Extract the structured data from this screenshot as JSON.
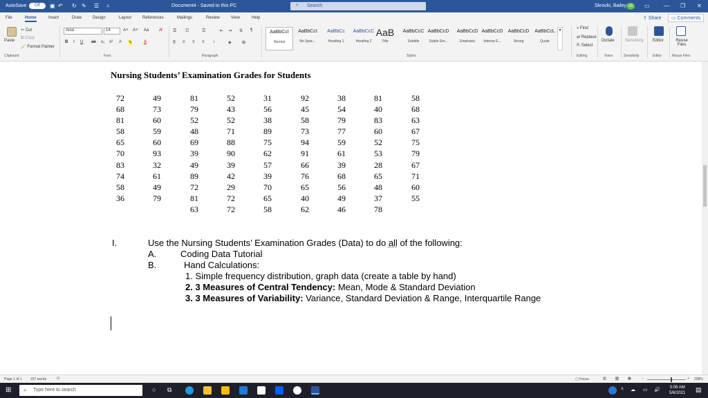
{
  "titlebar": {
    "autosave_label": "AutoSave",
    "autosave_state": "Off",
    "doc_title": "Document4 - Saved to this PC",
    "search_placeholder": "Search",
    "user_name": "Skrocki, Bailey",
    "user_initials": "SB"
  },
  "menu": {
    "tabs": [
      "File",
      "Home",
      "Insert",
      "Draw",
      "Design",
      "Layout",
      "References",
      "Mailings",
      "Review",
      "View",
      "Help"
    ],
    "share": "Share",
    "comments": "Comments"
  },
  "ribbon": {
    "clipboard": {
      "paste": "Paste",
      "cut": "Cut",
      "copy": "Copy",
      "format_painter": "Format Painter",
      "label": "Clipboard"
    },
    "font": {
      "name": "Arial",
      "size": "14",
      "label": "Font"
    },
    "paragraph": {
      "label": "Paragraph"
    },
    "styles": {
      "items": [
        {
          "sample": "AaBbCcI",
          "name": "Normal"
        },
        {
          "sample": "AaBbCcI",
          "name": "No Spac..."
        },
        {
          "sample": "AaBbCc",
          "name": "Heading 1"
        },
        {
          "sample": "AaBbCcC",
          "name": "Heading 2"
        },
        {
          "sample": "AaB",
          "name": "Title"
        },
        {
          "sample": "AaBbCcC",
          "name": "Subtitle"
        },
        {
          "sample": "AaBbCcD",
          "name": "Subtle Em..."
        },
        {
          "sample": "AaBbCcD",
          "name": "Emphasis"
        },
        {
          "sample": "AaBbCcD",
          "name": "Intense E..."
        },
        {
          "sample": "AaBbCcD",
          "name": "Strong"
        },
        {
          "sample": "AaBbCcL",
          "name": "Quote"
        }
      ],
      "label": "Styles"
    },
    "editing": {
      "find": "Find",
      "replace": "Replace",
      "select": "Select",
      "label": "Editing"
    },
    "voice": {
      "dictate": "Dictate",
      "label": "Voice"
    },
    "sensitivity": {
      "label": "Sensitivity"
    },
    "editor": {
      "editor": "Editor",
      "label": "Editor"
    },
    "reuse": {
      "reuse": "Reuse Files",
      "label": "Reuse Files"
    }
  },
  "document": {
    "title": "Nursing Students’ Examination Grades for Students",
    "columns": [
      [
        "72",
        "68",
        "81",
        "58",
        "65",
        "70",
        "83",
        "74",
        "58",
        "36"
      ],
      [
        "49",
        "73",
        "60",
        "59",
        "60",
        "93",
        "32",
        "61",
        "49",
        "79"
      ],
      [
        "81",
        "79",
        "52",
        "48",
        "69",
        "39",
        "49",
        "89",
        "72",
        "81",
        "63"
      ],
      [
        "52",
        "43",
        "52",
        "71",
        "88",
        "90",
        "39",
        "42",
        "29",
        "72",
        "72"
      ],
      [
        "31",
        "56",
        "38",
        "89",
        "75",
        "62",
        "57",
        "39",
        "70",
        "65",
        "58"
      ],
      [
        "92",
        "45",
        "58",
        "73",
        "94",
        "91",
        "66",
        "76",
        "65",
        "40",
        "62"
      ],
      [
        "38",
        "54",
        "79",
        "77",
        "59",
        "61",
        "39",
        "68",
        "56",
        "49",
        "46"
      ],
      [
        "81",
        "40",
        "83",
        "60",
        "52",
        "53",
        "28",
        "65",
        "48",
        "37",
        "78"
      ],
      [
        "58",
        "68",
        "63",
        "67",
        "75",
        "79",
        "67",
        "71",
        "60",
        "55"
      ]
    ],
    "instructions": {
      "roman": "I.",
      "intro_pre": "Use the Nursing Students’ Examination Grades (Data) to do ",
      "intro_all": "all",
      "intro_post": " of the following:",
      "a_letter": "A.",
      "a_text": "Coding Data Tutorial",
      "b_letter": "B.",
      "b_text": "Hand Calculations:",
      "item1": "1. Simple frequency distribution, graph data (create a table by hand)",
      "item2_bold": "2. 3 Measures of Central Tendency:",
      "item2_rest": " Mean, Mode & Standard Deviation",
      "item3_bold": "3. 3 Measures of Variability:",
      "item3_rest": " Variance, Standard Deviation & Range, Interquartile Range"
    }
  },
  "status": {
    "page": "Page 1 of 1",
    "words": "157 words",
    "focus": "Focus",
    "zoom": "208%"
  },
  "taskbar": {
    "search_placeholder": "Type here to search",
    "time": "3:06 AM",
    "date": "5/6/2021"
  },
  "colors": {
    "accent": "#2b579a"
  }
}
